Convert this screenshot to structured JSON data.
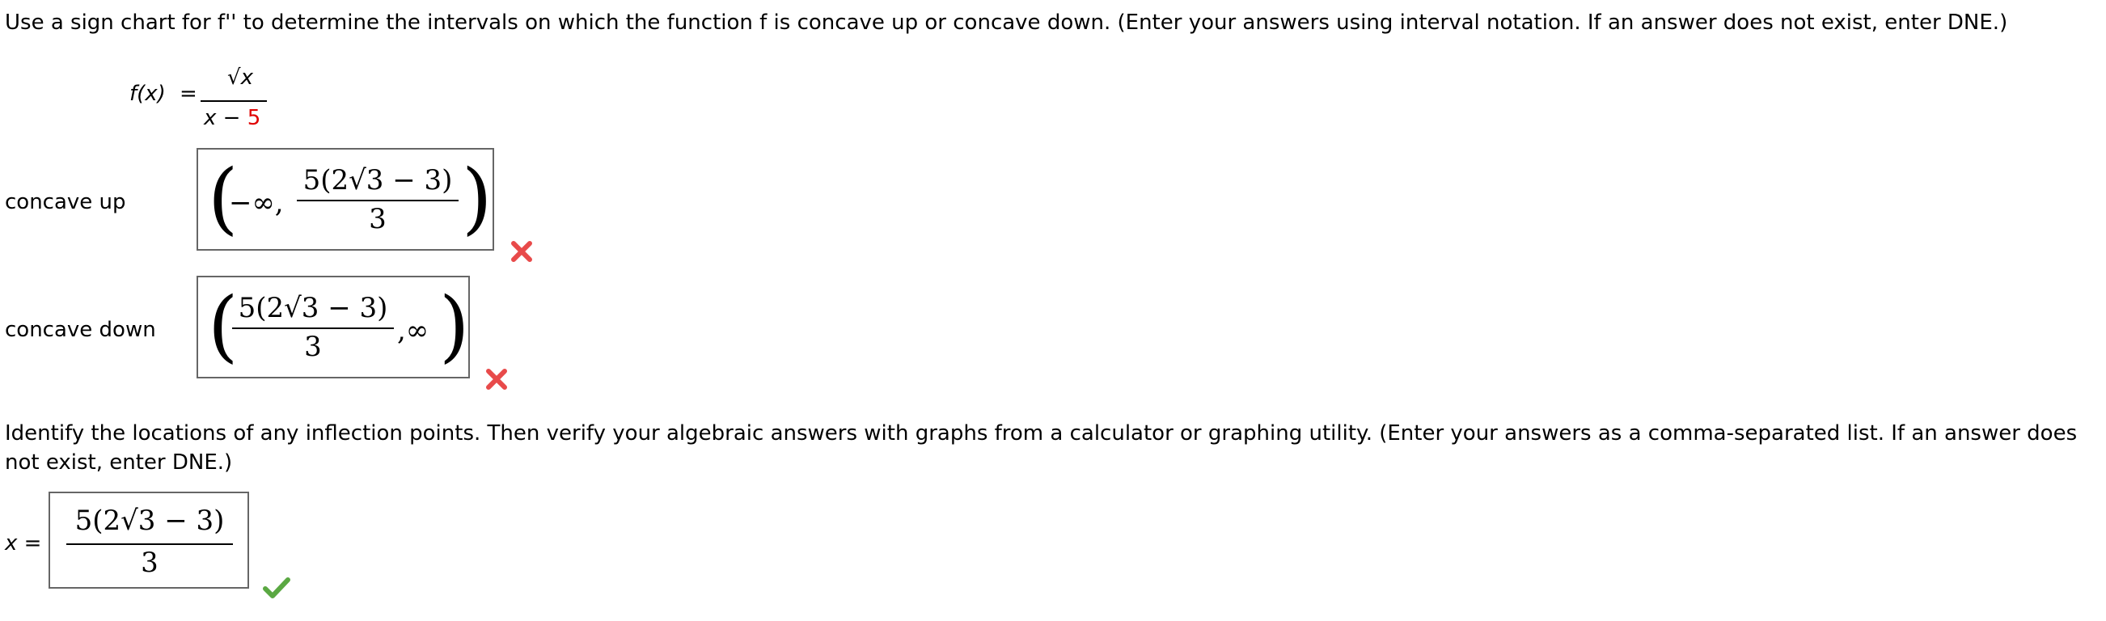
{
  "question1": {
    "instruction": "Use a sign chart for f'' to determine the intervals on which the function f is concave up or concave down. (Enter your answers using interval notation. If an answer does not exist, enter DNE.)",
    "function_lhs": "f(x)",
    "equals": "=",
    "numerator": "√x",
    "denominator_var": "x",
    "denominator_op": "−",
    "denominator_const": "5"
  },
  "concave_up": {
    "label": "concave up",
    "left": "−∞,",
    "numerator": "5(2√3 − 3)",
    "denominator": "3",
    "status_icon": "cross-icon",
    "status_color": "#e84a4a"
  },
  "concave_down": {
    "label": "concave down",
    "numerator": "5(2√3 − 3)",
    "denominator": "3",
    "right": ",∞",
    "status_icon": "cross-icon",
    "status_color": "#e84a4a"
  },
  "question2": {
    "instruction_line1": "Identify the locations of any inflection points. Then verify your algebraic answers with graphs from a calculator or graphing utility. (Enter your answers as a comma-separated list. If an answer does",
    "instruction_line2": "not exist, enter DNE.)",
    "x_label": "x",
    "equals": "=",
    "numerator": "5(2√3 − 3)",
    "denominator": "3",
    "status_icon": "check-icon",
    "status_color": "#5aa842"
  }
}
